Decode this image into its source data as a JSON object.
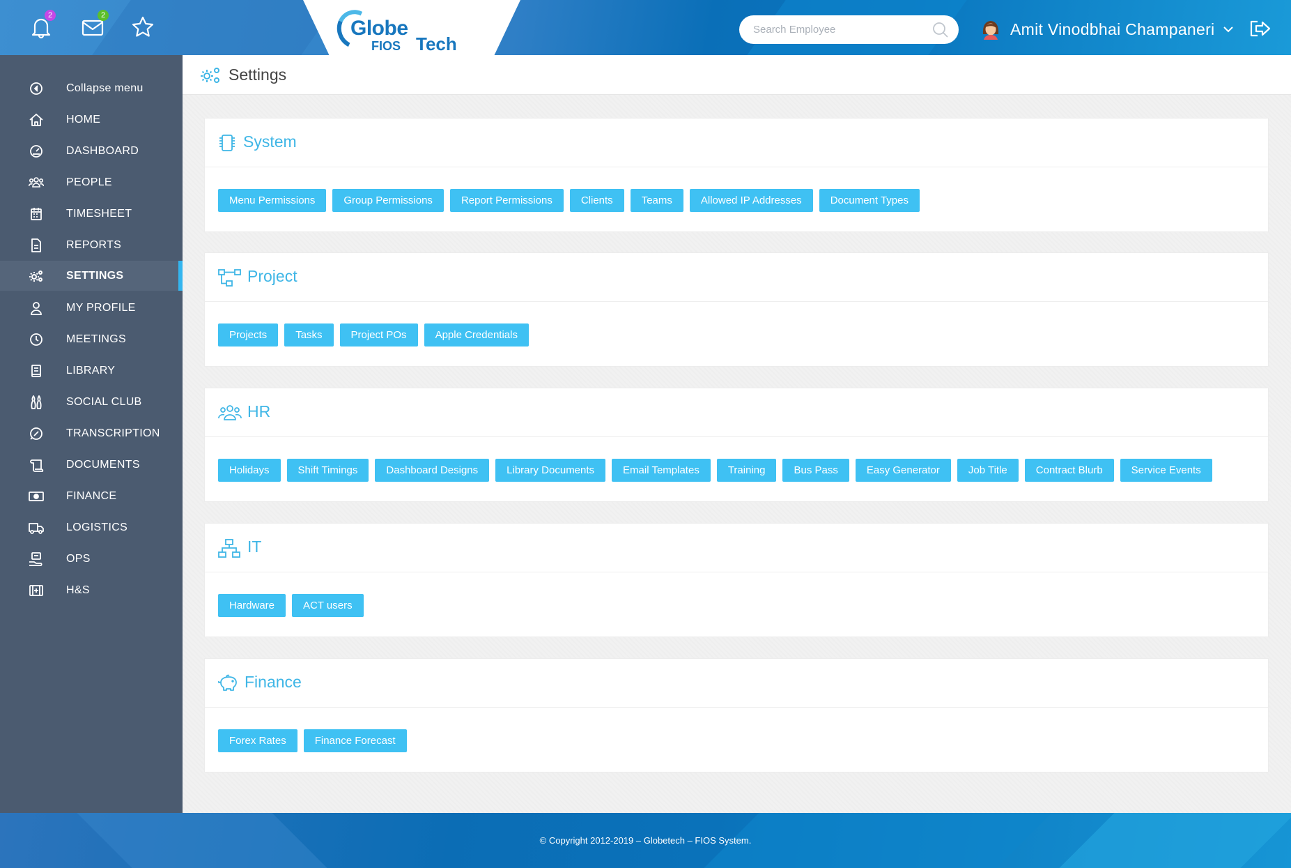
{
  "header": {
    "notifications_count": "2",
    "messages_count": "2",
    "logo": {
      "globe": "Globe",
      "fios": "FIOS",
      "tech": "Tech"
    },
    "search_placeholder": "Search Employee",
    "user_name": "Amit Vinodbhai Champaneri",
    "colors": {
      "notif_badge": "#c548e6",
      "msg_badge": "#5cbf2a"
    }
  },
  "sidebar": {
    "items": [
      {
        "label": "Collapse menu",
        "icon": "collapse-icon"
      },
      {
        "label": "HOME",
        "icon": "home-icon"
      },
      {
        "label": "DASHBOARD",
        "icon": "dashboard-icon"
      },
      {
        "label": "PEOPLE",
        "icon": "people-icon"
      },
      {
        "label": "TIMESHEET",
        "icon": "calendar-icon"
      },
      {
        "label": "REPORTS",
        "icon": "report-icon"
      },
      {
        "label": "SETTINGS",
        "icon": "gear-icon",
        "active": true
      },
      {
        "label": "MY PROFILE",
        "icon": "user-icon"
      },
      {
        "label": "MEETINGS",
        "icon": "clock-icon"
      },
      {
        "label": "LIBRARY",
        "icon": "book-icon"
      },
      {
        "label": "SOCIAL CLUB",
        "icon": "bowling-icon"
      },
      {
        "label": "TRANSCRIPTION",
        "icon": "speedometer-icon"
      },
      {
        "label": "DOCUMENTS",
        "icon": "scroll-icon"
      },
      {
        "label": "FINANCE",
        "icon": "money-icon"
      },
      {
        "label": "LOGISTICS",
        "icon": "truck-icon"
      },
      {
        "label": "OPS",
        "icon": "ops-icon"
      },
      {
        "label": "H&S",
        "icon": "medical-icon"
      }
    ]
  },
  "page": {
    "title": "Settings"
  },
  "sections": [
    {
      "title": "System",
      "icon": "chip-icon",
      "buttons": [
        "Menu Permissions",
        "Group Permissions",
        "Report Permissions",
        "Clients",
        "Teams",
        "Allowed IP Addresses",
        "Document Types"
      ]
    },
    {
      "title": "Project",
      "icon": "project-flow-icon",
      "buttons": [
        "Projects",
        "Tasks",
        "Project POs",
        "Apple Credentials"
      ]
    },
    {
      "title": "HR",
      "icon": "hr-group-icon",
      "buttons": [
        "Holidays",
        "Shift Timings",
        "Dashboard Designs",
        "Library Documents",
        "Email Templates",
        "Training",
        "Bus Pass",
        "Easy Generator",
        "Job Title",
        "Contract Blurb",
        "Service Events"
      ]
    },
    {
      "title": "IT",
      "icon": "network-icon",
      "buttons": [
        "Hardware",
        "ACT users"
      ]
    },
    {
      "title": "Finance",
      "icon": "piggy-bank-icon",
      "buttons": [
        "Forex Rates",
        "Finance Forecast"
      ]
    }
  ],
  "footer": {
    "copyright": "© Copyright 2012-2019 – Globetech – FIOS System."
  },
  "colors": {
    "accent": "#3fc1f3",
    "sidebar": "#4b5b70",
    "section_title": "#3fb6e6"
  }
}
